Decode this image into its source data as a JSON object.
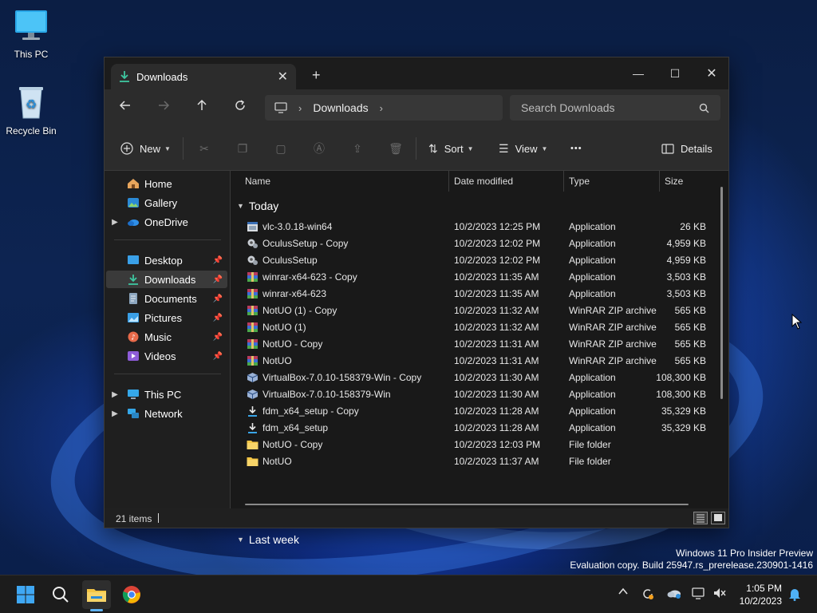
{
  "desktop": {
    "icons": [
      {
        "label": "This PC"
      },
      {
        "label": "Recycle Bin"
      }
    ],
    "watermark": {
      "line1": "Windows 11 Pro Insider Preview",
      "line2": "Evaluation copy. Build 25947.rs_prerelease.230901-1416"
    }
  },
  "window": {
    "tab": {
      "title": "Downloads",
      "close": "✕"
    },
    "new_tab": "+",
    "controls": {
      "minimize": "—",
      "maximize": "☐",
      "close": "✕"
    },
    "address": {
      "root_icon": "computer-icon",
      "location": "Downloads"
    },
    "search": {
      "placeholder": "Search Downloads"
    },
    "commands": {
      "new": "New",
      "sort": "Sort",
      "view": "View",
      "more": "•••",
      "details": "Details"
    },
    "sidebar": {
      "items": [
        {
          "label": "Home",
          "icon": "home-icon"
        },
        {
          "label": "Gallery",
          "icon": "gallery-icon"
        },
        {
          "label": "OneDrive",
          "icon": "cloud-icon",
          "expandable": true
        },
        {
          "label": "Desktop",
          "icon": "desktop-icon",
          "pinned": true
        },
        {
          "label": "Downloads",
          "icon": "download-icon",
          "pinned": true,
          "selected": true
        },
        {
          "label": "Documents",
          "icon": "document-icon",
          "pinned": true
        },
        {
          "label": "Pictures",
          "icon": "picture-icon",
          "pinned": true
        },
        {
          "label": "Music",
          "icon": "music-icon",
          "pinned": true
        },
        {
          "label": "Videos",
          "icon": "video-icon",
          "pinned": true
        },
        {
          "label": "This PC",
          "icon": "computer-icon",
          "expandable": true
        },
        {
          "label": "Network",
          "icon": "network-icon",
          "expandable": true
        }
      ]
    },
    "columns": {
      "name": "Name",
      "date": "Date modified",
      "type": "Type",
      "size": "Size"
    },
    "groups": {
      "today": "Today",
      "last_week": "Last week"
    },
    "files": [
      {
        "name": "vlc-3.0.18-win64",
        "date": "10/2/2023 12:25 PM",
        "type": "Application",
        "size": "26 KB",
        "icon": "installer-icon"
      },
      {
        "name": "OculusSetup - Copy",
        "date": "10/2/2023 12:02 PM",
        "type": "Application",
        "size": "4,959 KB",
        "icon": "gear-icon"
      },
      {
        "name": "OculusSetup",
        "date": "10/2/2023 12:02 PM",
        "type": "Application",
        "size": "4,959 KB",
        "icon": "gear-icon"
      },
      {
        "name": "winrar-x64-623 - Copy",
        "date": "10/2/2023 11:35 AM",
        "type": "Application",
        "size": "3,503 KB",
        "icon": "archive-icon"
      },
      {
        "name": "winrar-x64-623",
        "date": "10/2/2023 11:35 AM",
        "type": "Application",
        "size": "3,503 KB",
        "icon": "archive-icon"
      },
      {
        "name": "NotUO (1) - Copy",
        "date": "10/2/2023 11:32 AM",
        "type": "WinRAR ZIP archive",
        "size": "565 KB",
        "icon": "archive-icon"
      },
      {
        "name": "NotUO (1)",
        "date": "10/2/2023 11:32 AM",
        "type": "WinRAR ZIP archive",
        "size": "565 KB",
        "icon": "archive-icon"
      },
      {
        "name": "NotUO - Copy",
        "date": "10/2/2023 11:31 AM",
        "type": "WinRAR ZIP archive",
        "size": "565 KB",
        "icon": "archive-icon"
      },
      {
        "name": "NotUO",
        "date": "10/2/2023 11:31 AM",
        "type": "WinRAR ZIP archive",
        "size": "565 KB",
        "icon": "archive-icon"
      },
      {
        "name": "VirtualBox-7.0.10-158379-Win - Copy",
        "date": "10/2/2023 11:30 AM",
        "type": "Application",
        "size": "108,300 KB",
        "icon": "cube-icon"
      },
      {
        "name": "VirtualBox-7.0.10-158379-Win",
        "date": "10/2/2023 11:30 AM",
        "type": "Application",
        "size": "108,300 KB",
        "icon": "cube-icon"
      },
      {
        "name": "fdm_x64_setup - Copy",
        "date": "10/2/2023 11:28 AM",
        "type": "Application",
        "size": "35,329 KB",
        "icon": "download-icon"
      },
      {
        "name": "fdm_x64_setup",
        "date": "10/2/2023 11:28 AM",
        "type": "Application",
        "size": "35,329 KB",
        "icon": "download-icon"
      },
      {
        "name": "NotUO - Copy",
        "date": "10/2/2023 12:03 PM",
        "type": "File folder",
        "size": "",
        "icon": "folder-icon"
      },
      {
        "name": "NotUO",
        "date": "10/2/2023 11:37 AM",
        "type": "File folder",
        "size": "",
        "icon": "folder-icon"
      }
    ],
    "status": {
      "count": "21 items"
    }
  },
  "taskbar": {
    "clock": {
      "time": "1:05 PM",
      "date": "10/2/2023"
    }
  },
  "colors": {
    "accent": "#5fb2f2",
    "folder": "#f3c544",
    "selected": "#3a3a3a"
  }
}
